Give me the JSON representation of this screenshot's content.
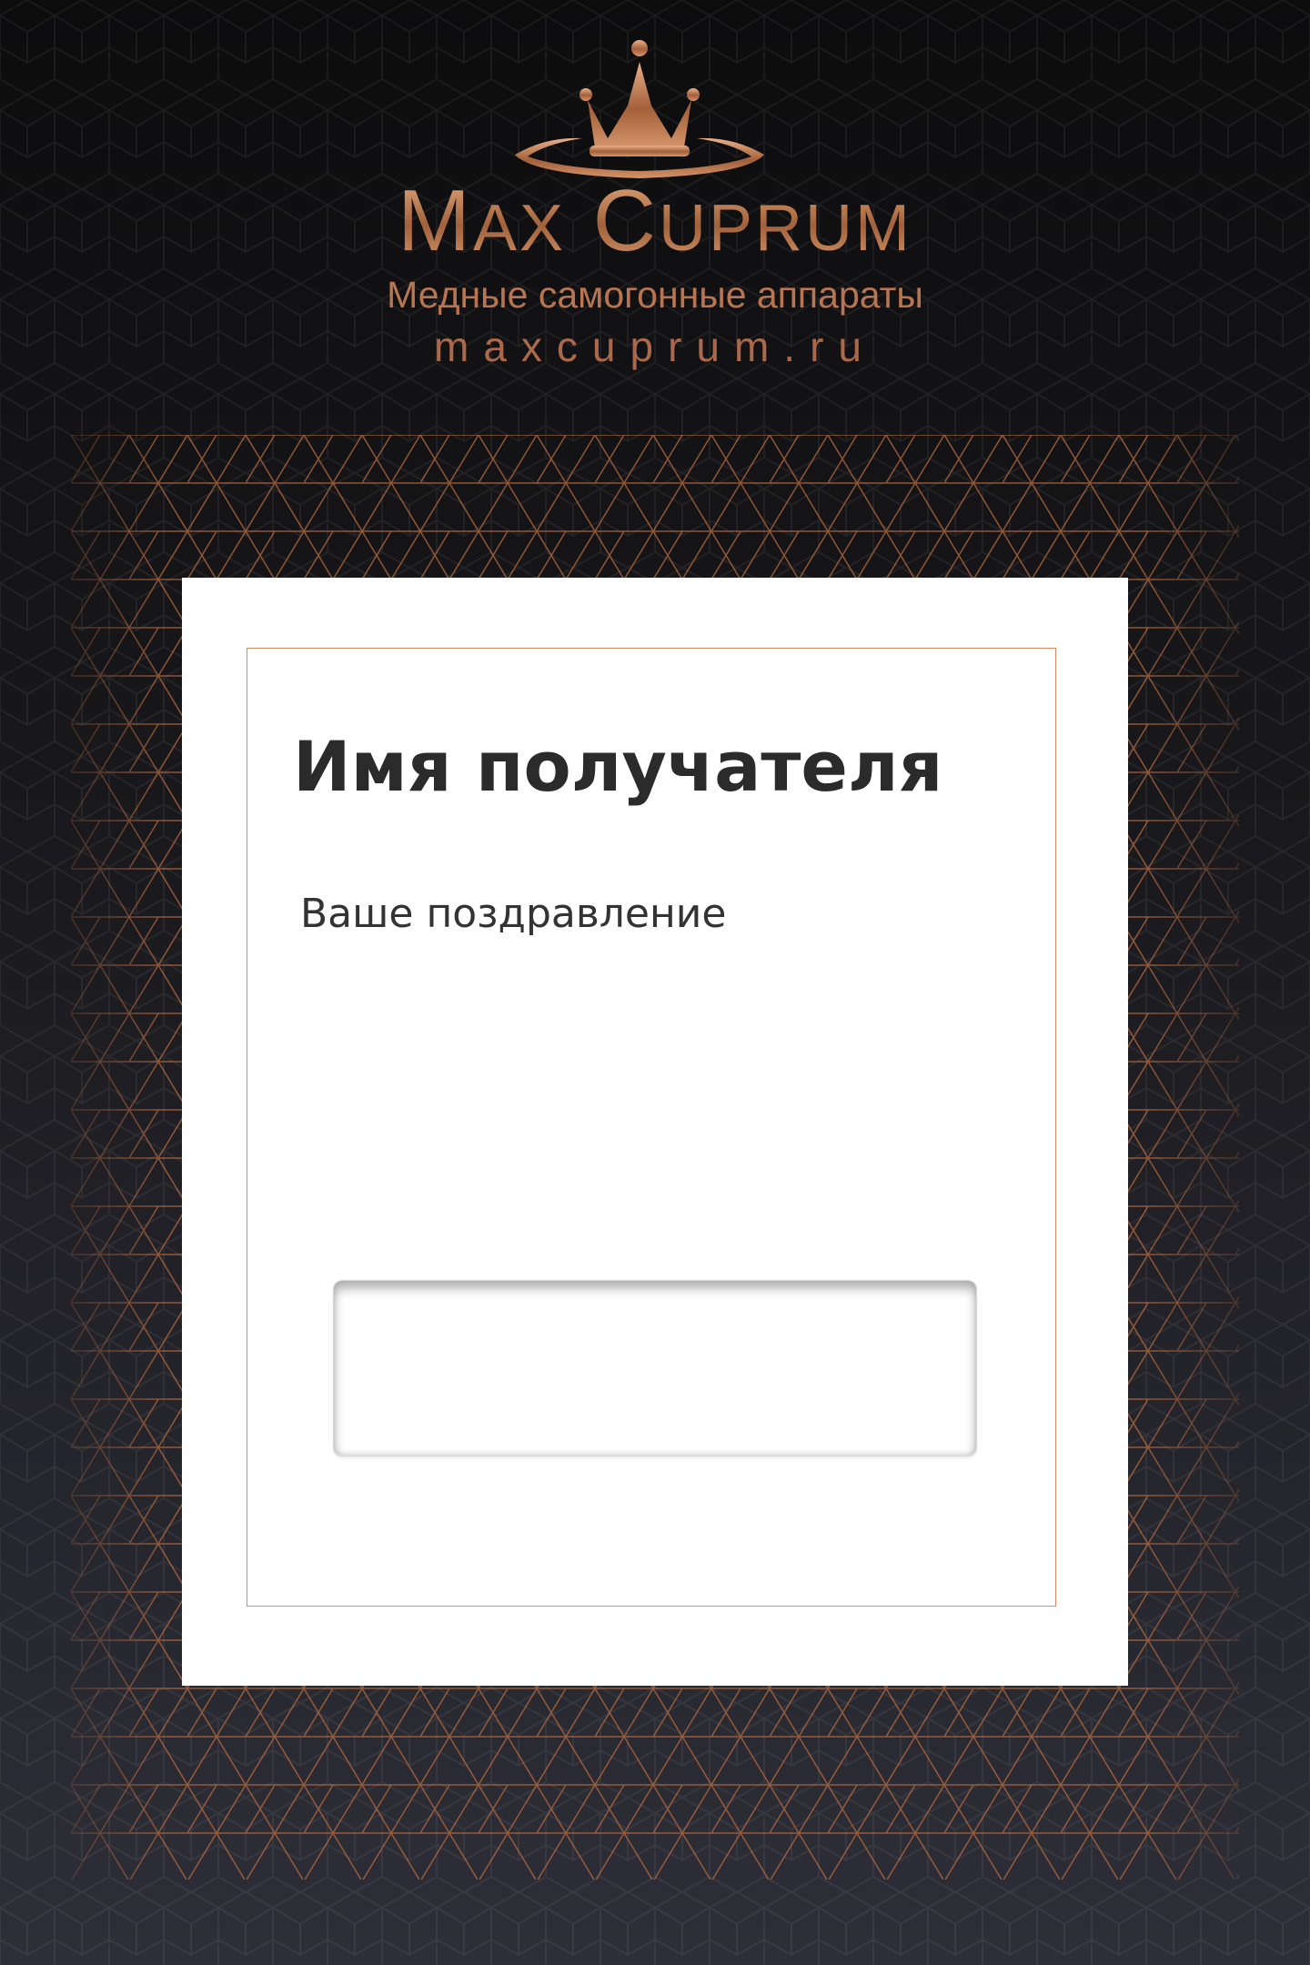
{
  "brand": {
    "name_first": "M",
    "name_first_rest": "AX",
    "name_second": "C",
    "name_second_rest": "UPRUM",
    "tagline": "Медные самогонные аппараты",
    "url": "maxcuprum.ru",
    "logo_icon": "crown-icon",
    "accent_color": "#c7855a"
  },
  "card": {
    "recipient_name": "Имя получателя",
    "message": "Ваше поздравление",
    "frame_color": "#d58c62"
  },
  "colors": {
    "background_top": "#0c0c0d",
    "background_bottom": "#2e2e38",
    "lattice_line": "#b86a40"
  }
}
